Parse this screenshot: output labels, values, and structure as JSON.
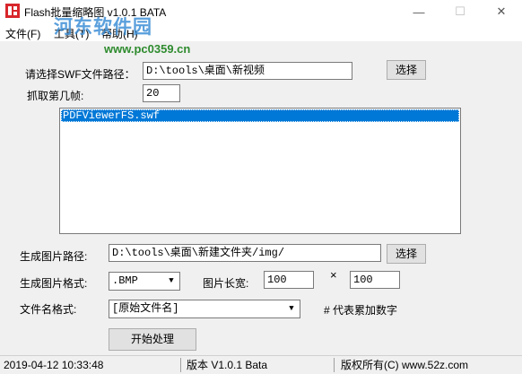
{
  "window": {
    "title": "Flash批量缩略图 v1.0.1 BATA",
    "minimize": "—",
    "maximize": "☐",
    "close": "✕"
  },
  "watermark": {
    "name": "河东软件园",
    "url": "www.pc0359.cn"
  },
  "menu": {
    "file": "文件(F)",
    "tools": "工具(T)",
    "help": "帮助(H)"
  },
  "form": {
    "swf_path_label": "请选择SWF文件路径：",
    "swf_path_value": "D:\\tools\\桌面\\新视频",
    "select_label": "选择",
    "frame_label": "抓取第几帧:",
    "frame_value": "20",
    "files": [
      "PDFViewerFS.swf"
    ],
    "output_path_label": "生成图片路径:",
    "output_path_value": "D:\\tools\\桌面\\新建文件夹/img/",
    "output_select_label": "选择",
    "format_label": "生成图片格式:",
    "format_value": ".BMP",
    "size_label": "图片长宽:",
    "width_value": "100",
    "times": "×",
    "height_value": "100",
    "filename_label": "文件名格式:",
    "filename_value": "[原始文件名]",
    "hint": "# 代表累加数字",
    "start_label": "开始处理"
  },
  "status": {
    "datetime": "2019-04-12 10:33:48",
    "version": "版本 V1.0.1 Bata",
    "copyright": "版权所有(C) www.52z.com"
  },
  "icons": {
    "app": "app-logo-icon",
    "dropdown": "chevron-down-icon"
  },
  "colors": {
    "selection": "#0078d7",
    "app_icon": "#d8262b",
    "watermark_blue": "#3d8fd6",
    "watermark_green": "#2e8b2e"
  }
}
